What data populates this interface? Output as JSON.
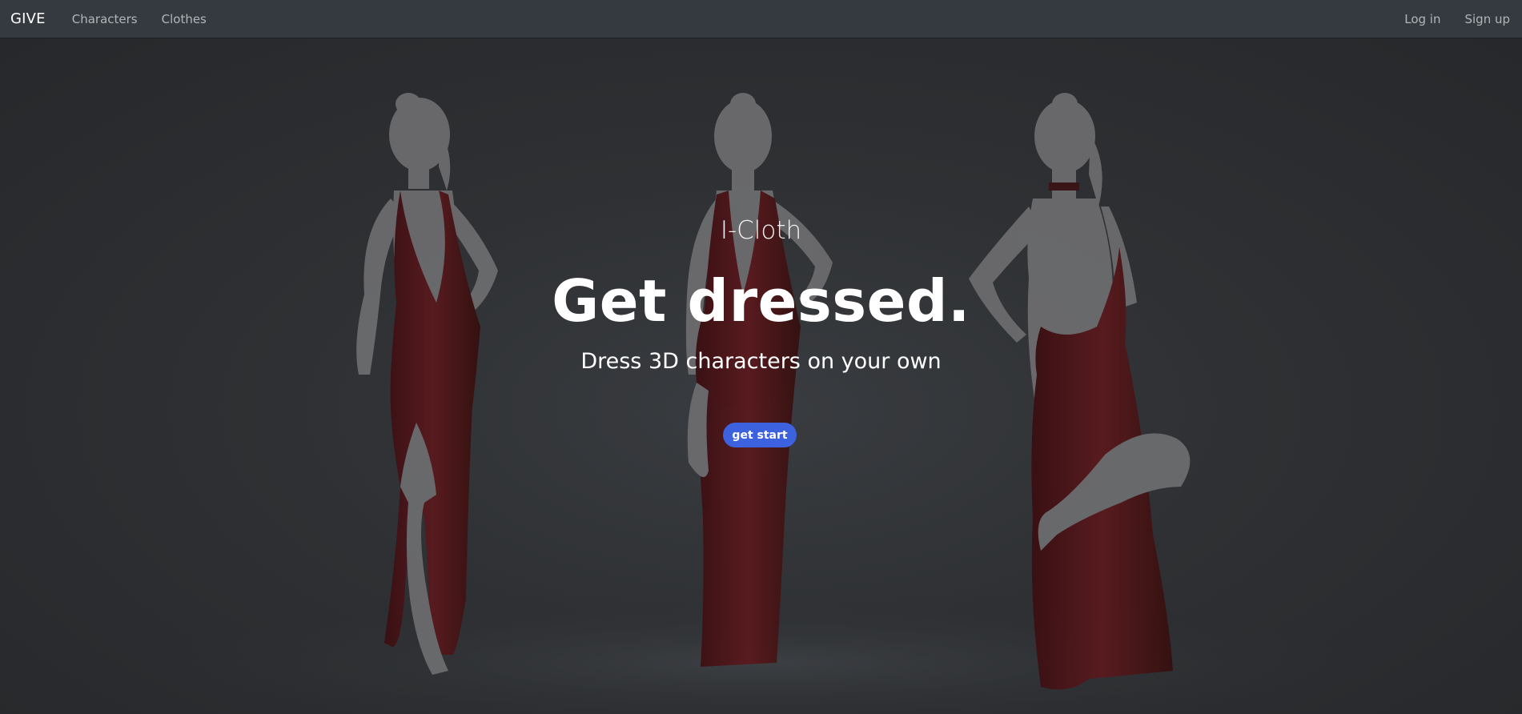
{
  "navbar": {
    "brand": "GIVE",
    "links": [
      {
        "label": "Characters"
      },
      {
        "label": "Clothes"
      }
    ],
    "auth": {
      "login": "Log in",
      "signup": "Sign up"
    }
  },
  "hero": {
    "subtitle": "I-Cloth",
    "headline": "Get dressed.",
    "lead": "Dress 3D characters on your own",
    "cta_label": "get start"
  },
  "colors": {
    "navbar_bg": "#343a40",
    "hero_bg": "#2e3033",
    "cta": "#3d62e0",
    "dress": "#4a1418",
    "silhouette": "#6e6e70"
  }
}
